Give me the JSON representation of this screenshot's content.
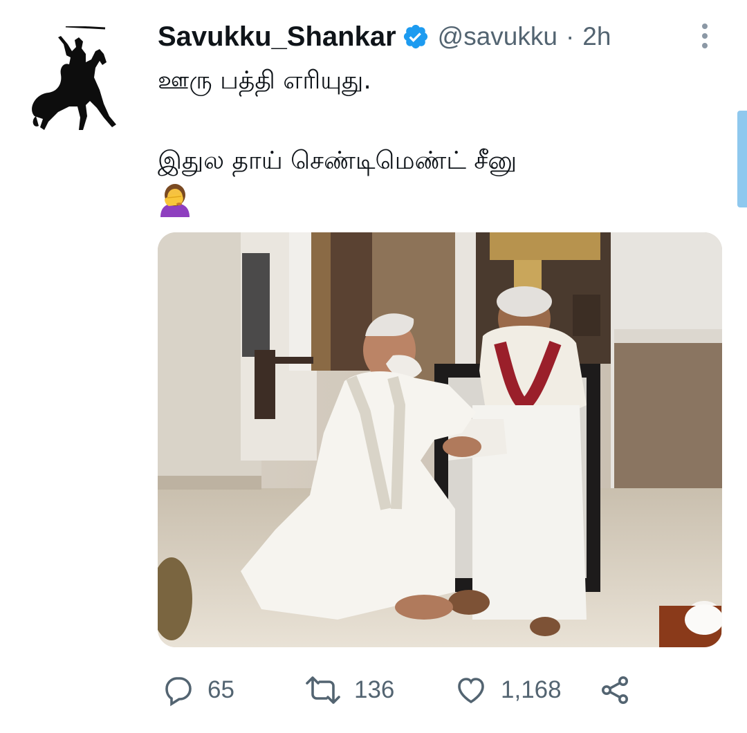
{
  "tweet": {
    "display_name": "Savukku_Shankar",
    "handle": "@savukku",
    "separator": "·",
    "time": "2h",
    "text_line1": "ஊரு பத்தி எரியுது.",
    "text_line2": "இதுல தாய் செண்டிமெண்ட் சீனு",
    "emoji": "woman-facepalming",
    "replies": "65",
    "retweets": "136",
    "likes": "1,168"
  },
  "colors": {
    "verified": "#1d9bf0",
    "secondary_text": "#536471",
    "primary_text": "#0f1419",
    "scroll_indicator": "#8fc8ee"
  },
  "icons": {
    "avatar": "horse-rider-silhouette",
    "more": "more-vertical-icon",
    "verified": "verified-badge-icon",
    "reply": "reply-icon",
    "retweet": "retweet-icon",
    "like": "heart-icon",
    "share": "share-icon"
  }
}
